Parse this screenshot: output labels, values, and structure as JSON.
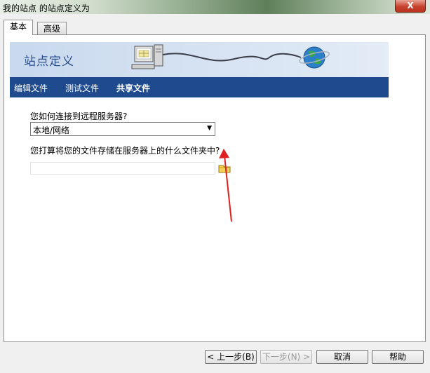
{
  "window": {
    "title": "我的站点 的站点定义为",
    "close_label": "X"
  },
  "tabs": [
    {
      "label": "基本"
    },
    {
      "label": "高级"
    }
  ],
  "banner": {
    "title": "站点定义"
  },
  "nav": [
    {
      "label": "编辑文件"
    },
    {
      "label": "测试文件"
    },
    {
      "label": "共享文件",
      "active": true
    }
  ],
  "form": {
    "connect_question": "您如何连接到远程服务器?",
    "connect_value": "本地/网络",
    "folder_question": "您打算将您的文件存储在服务器上的什么文件夹中?",
    "folder_value": ""
  },
  "buttons": {
    "back": "< 上一步(B)",
    "next": "下一步(N) >",
    "cancel": "取消",
    "help": "帮助"
  },
  "colors": {
    "accent": "#1f4b8e",
    "annotation_arrow": "#e02020"
  }
}
